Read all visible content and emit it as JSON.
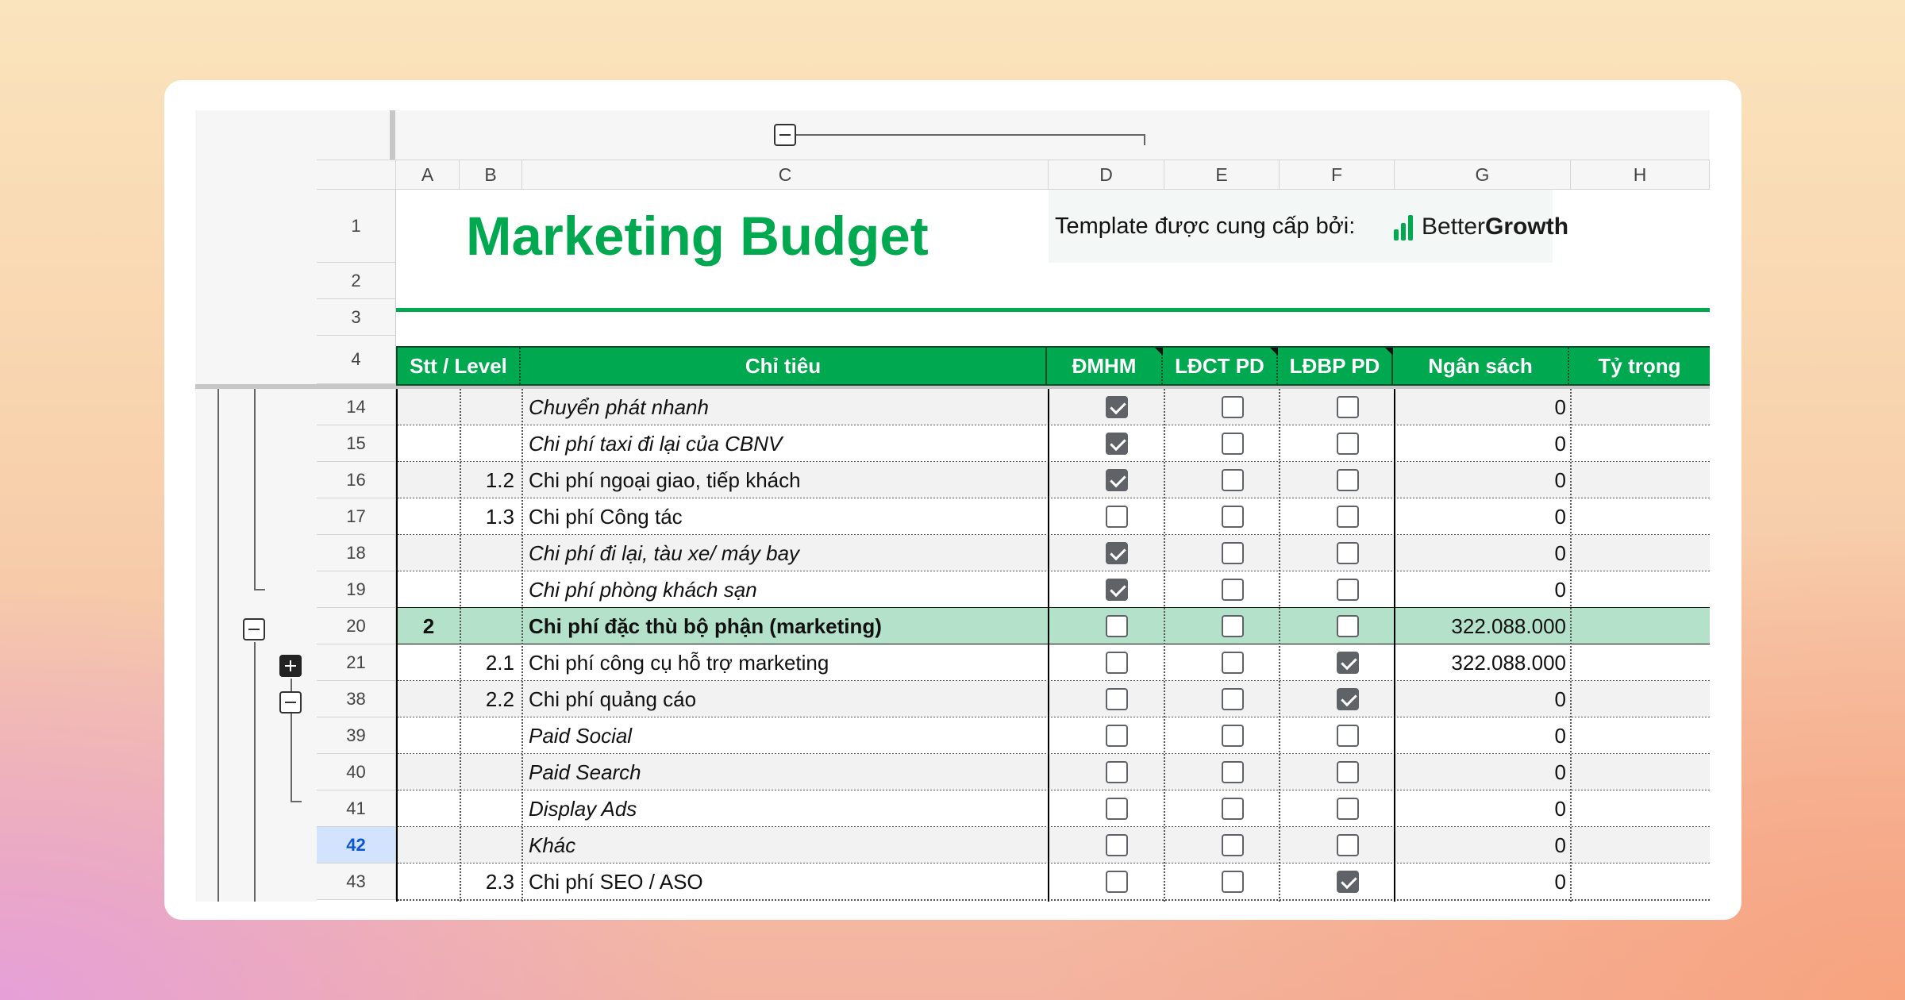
{
  "title": "Marketing Budget",
  "template_label": "Template được cung cấp bởi:",
  "brand": {
    "part1": "Better",
    "part2": "Growth",
    "color": "#00a84f"
  },
  "columns": [
    "A",
    "B",
    "C",
    "D",
    "E",
    "F",
    "G",
    "H"
  ],
  "top_rows": [
    "1",
    "2",
    "3",
    "4"
  ],
  "table_headers": [
    "Stt / Level",
    "Chỉ tiêu",
    "ĐMHM",
    "LĐCT PD",
    "LĐBP PD",
    "Ngân sách",
    "Tỷ trọng"
  ],
  "rows": [
    {
      "num": "14",
      "stt": "",
      "level": "",
      "name": "Chuyển phát nhanh",
      "italic": true,
      "checks": [
        true,
        false,
        false
      ],
      "budget": "0"
    },
    {
      "num": "15",
      "stt": "",
      "level": "",
      "name": "Chi phí taxi đi lại của CBNV",
      "italic": true,
      "checks": [
        true,
        false,
        false
      ],
      "budget": "0"
    },
    {
      "num": "16",
      "stt": "",
      "level": "1.2",
      "name": "Chi phí ngoại giao, tiếp khách",
      "italic": false,
      "checks": [
        true,
        false,
        false
      ],
      "budget": "0"
    },
    {
      "num": "17",
      "stt": "",
      "level": "1.3",
      "name": "Chi phí Công tác",
      "italic": false,
      "checks": [
        false,
        false,
        false
      ],
      "budget": "0"
    },
    {
      "num": "18",
      "stt": "",
      "level": "",
      "name": "Chi phí đi lại, tàu xe/ máy bay",
      "italic": true,
      "checks": [
        true,
        false,
        false
      ],
      "budget": "0"
    },
    {
      "num": "19",
      "stt": "",
      "level": "",
      "name": "Chi phí phòng khách sạn",
      "italic": true,
      "checks": [
        true,
        false,
        false
      ],
      "budget": "0"
    },
    {
      "num": "20",
      "stt": "2",
      "level": "",
      "name": "Chi phí đặc thù bộ phận (marketing)",
      "italic": false,
      "bold": true,
      "highlight": true,
      "checks": [
        false,
        false,
        false
      ],
      "budget": "322.088.000"
    },
    {
      "num": "21",
      "stt": "",
      "level": "2.1",
      "name": "Chi phí công cụ hỗ trợ marketing",
      "italic": false,
      "checks": [
        false,
        false,
        true
      ],
      "budget": "322.088.000"
    },
    {
      "num": "38",
      "stt": "",
      "level": "2.2",
      "name": "Chi phí quảng cáo",
      "italic": false,
      "checks": [
        false,
        false,
        true
      ],
      "budget": "0"
    },
    {
      "num": "39",
      "stt": "",
      "level": "",
      "name": "Paid Social",
      "italic": true,
      "checks": [
        false,
        false,
        false
      ],
      "budget": "0"
    },
    {
      "num": "40",
      "stt": "",
      "level": "",
      "name": "Paid Search",
      "italic": true,
      "checks": [
        false,
        false,
        false
      ],
      "budget": "0"
    },
    {
      "num": "41",
      "stt": "",
      "level": "",
      "name": "Display Ads",
      "italic": true,
      "checks": [
        false,
        false,
        false
      ],
      "budget": "0"
    },
    {
      "num": "42",
      "stt": "",
      "level": "",
      "name": "Khác",
      "italic": true,
      "selected": true,
      "checks": [
        false,
        false,
        false
      ],
      "budget": "0"
    },
    {
      "num": "43",
      "stt": "",
      "level": "2.3",
      "name": "Chi phí SEO / ASO",
      "italic": false,
      "checks": [
        false,
        false,
        true
      ],
      "budget": "0"
    }
  ],
  "colors": {
    "header_green": "#00a84f",
    "highlight_row": "#b3e1c9",
    "band": "#f2f2f2",
    "selected_row_header": "#d3e3fd"
  }
}
